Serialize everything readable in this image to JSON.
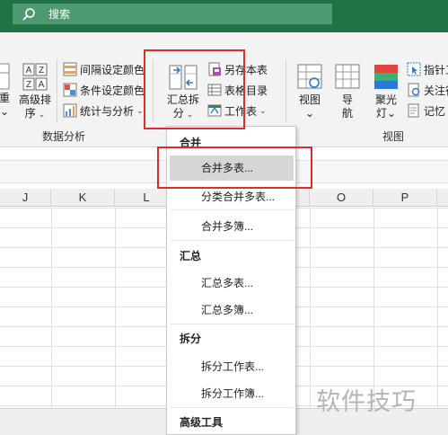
{
  "search": {
    "label": "搜索"
  },
  "ribbon": {
    "left_cut": {
      "line1": "重",
      "chev": "⌄"
    },
    "sort_button": {
      "line1": "高级排",
      "line2": "序",
      "chev": "⌄"
    },
    "analysis_items": [
      {
        "label": "间隔设定颜色",
        "icon": "interval-color-icon"
      },
      {
        "label": "条件设定颜色",
        "icon": "condition-color-icon"
      },
      {
        "label": "统计与分析",
        "icon": "stats-analysis-icon",
        "chev": "⌄"
      }
    ],
    "analysis_group_label": "数据分析",
    "summary_button": {
      "line1": "汇总拆",
      "line2": "分",
      "chev": "⌄"
    },
    "table_items": [
      {
        "label": "另存本表",
        "icon": "save-as-sheet-icon"
      },
      {
        "label": "表格目录",
        "icon": "sheet-directory-icon"
      },
      {
        "label": "工作表",
        "icon": "worksheet-icon",
        "chev": "⌄"
      }
    ],
    "view_buttons": [
      {
        "line1": "视图",
        "line2": "⌄",
        "icon": "view-icon"
      },
      {
        "line1": "导",
        "line2": "航",
        "icon": "navigation-icon"
      },
      {
        "line1": "聚光",
        "line2": "灯⌄",
        "icon": "spotlight-icon"
      }
    ],
    "view_small_items": [
      {
        "label": "指针工",
        "icon": "pointer-tool-icon"
      },
      {
        "label": "关注行",
        "icon": "focus-row-icon"
      },
      {
        "label": "记忆",
        "icon": "memory-icon"
      }
    ],
    "view_group_label": "视图"
  },
  "columns": [
    "J",
    "K",
    "L",
    "",
    "O",
    "P"
  ],
  "menu": {
    "sections": [
      {
        "header": "合并",
        "items": [
          "合并多表...",
          "分类合并多表...",
          "合并多簿..."
        ]
      },
      {
        "header": "汇总",
        "items": [
          "汇总多表...",
          "汇总多簿..."
        ]
      },
      {
        "header": "拆分",
        "items": [
          "拆分工作表...",
          "拆分工作簿..."
        ]
      },
      {
        "header": "高级工具",
        "items": []
      }
    ],
    "highlighted": "合并多表..."
  },
  "watermark": "软件技巧",
  "colors": {
    "title_bar": "#217346",
    "highlight_box": "#e02b2b",
    "menu_hover": "#d6d6d6"
  }
}
